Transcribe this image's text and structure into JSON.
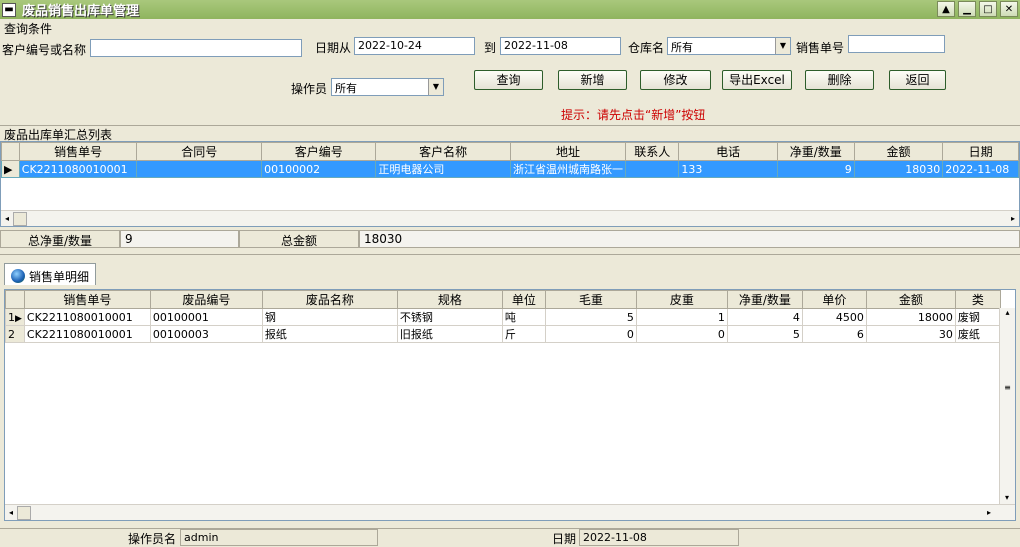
{
  "window": {
    "title": "废品销售出库单管理"
  },
  "query": {
    "group_label": "查询条件",
    "customer_label": "客户编号或名称",
    "customer_value": "",
    "date_from_label": "日期从",
    "date_from": "2022-10-24",
    "date_to_label": "到",
    "date_to": "2022-11-08",
    "warehouse_label": "仓库名",
    "warehouse_value": "所有",
    "sale_no_label": "销售单号",
    "sale_no_value": "",
    "operator_label": "操作员",
    "operator_value": "所有"
  },
  "buttons": {
    "query": "查询",
    "add": "新增",
    "edit": "修改",
    "export": "导出Excel",
    "delete": "删除",
    "back": "返回"
  },
  "hint": "提示：请先点击“新增”按钮",
  "hint_color": "#cc0000",
  "summary_list": {
    "title": "废品出库单汇总列表",
    "columns": [
      "销售单号",
      "合同号",
      "客户编号",
      "客户名称",
      "地址",
      "联系人",
      "电话",
      "净重/数量",
      "金额",
      "日期"
    ],
    "rows": [
      [
        "CK2211080010001",
        "",
        "00100002",
        "正明电器公司",
        "浙江省温州城南路张一",
        "",
        "133",
        "9",
        "18030",
        "2022-11-08"
      ]
    ]
  },
  "totals": {
    "qty_label": "总净重/数量",
    "qty_value": "9",
    "amount_label": "总金额",
    "amount_value": "18030"
  },
  "detail": {
    "tab_label": "销售单明细",
    "columns": [
      "销售单号",
      "废品编号",
      "废品名称",
      "规格",
      "单位",
      "毛重",
      "皮重",
      "净重/数量",
      "单价",
      "金额",
      "类"
    ],
    "rows": [
      [
        "1",
        "CK2211080010001",
        "00100001",
        "钢",
        "不锈钢",
        "吨",
        "5",
        "1",
        "4",
        "4500",
        "18000",
        "废钢"
      ],
      [
        "2",
        "CK2211080010001",
        "00100003",
        "报纸",
        "旧报纸",
        "斤",
        "0",
        "0",
        "5",
        "6",
        "30",
        "废纸"
      ]
    ]
  },
  "status": {
    "operator_label": "操作员名",
    "operator_value": "admin",
    "date_label": "日期",
    "date_value": "2022-11-08"
  }
}
